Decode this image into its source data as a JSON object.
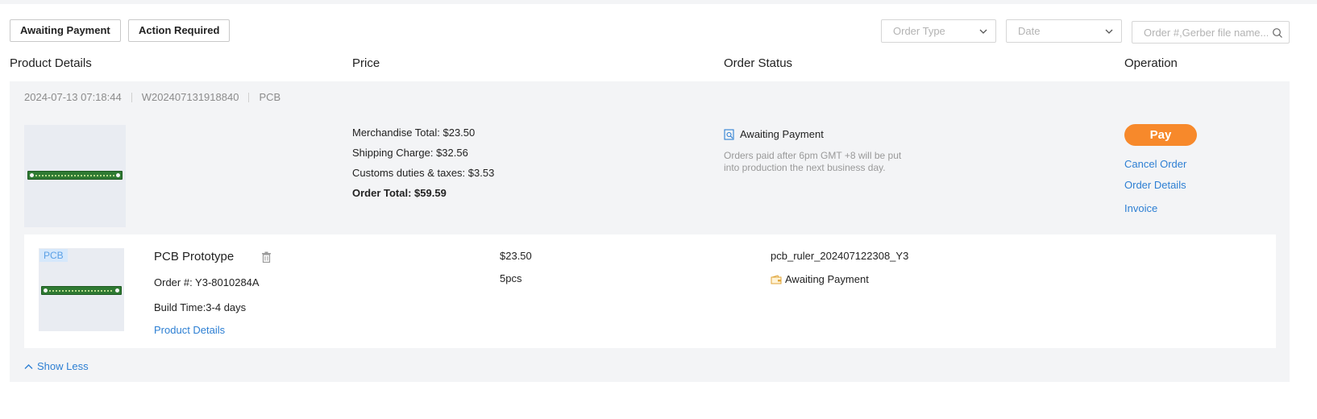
{
  "filters": {
    "awaiting_payment": "Awaiting Payment",
    "action_required": "Action Required",
    "order_type_placeholder": "Order Type",
    "date_placeholder": "Date",
    "search_placeholder": "Order #,Gerber file name..."
  },
  "columns": {
    "product": "Product Details",
    "price": "Price",
    "status": "Order Status",
    "operation": "Operation"
  },
  "order": {
    "date": "2024-07-13 07:18:44",
    "number": "W202407131918840",
    "type": "PCB",
    "merchandise_total": "Merchandise Total: $23.50",
    "shipping_charge": "Shipping Charge: $32.56",
    "customs": "Customs duties & taxes: $3.53",
    "order_total": "Order Total: $59.59",
    "status": "Awaiting Payment",
    "status_note": "Orders paid after 6pm GMT +8 will be put into production the next business day.",
    "operations": {
      "pay": "Pay",
      "cancel": "Cancel Order",
      "details": "Order Details",
      "invoice": "Invoice"
    }
  },
  "item": {
    "tag": "PCB",
    "title": "PCB Prototype",
    "order_no": "Order #: Y3-8010284A",
    "build_time": "Build Time:3-4 days",
    "details_link": "Product Details",
    "price": "$23.50",
    "quantity": "5pcs",
    "file": "pcb_ruler_202407122308_Y3",
    "status": "Awaiting Payment"
  },
  "show_less": "Show Less",
  "colors": {
    "accent_orange": "#f7892b",
    "link_blue": "#2d7fd3",
    "panel_bg": "#f3f4f6"
  }
}
